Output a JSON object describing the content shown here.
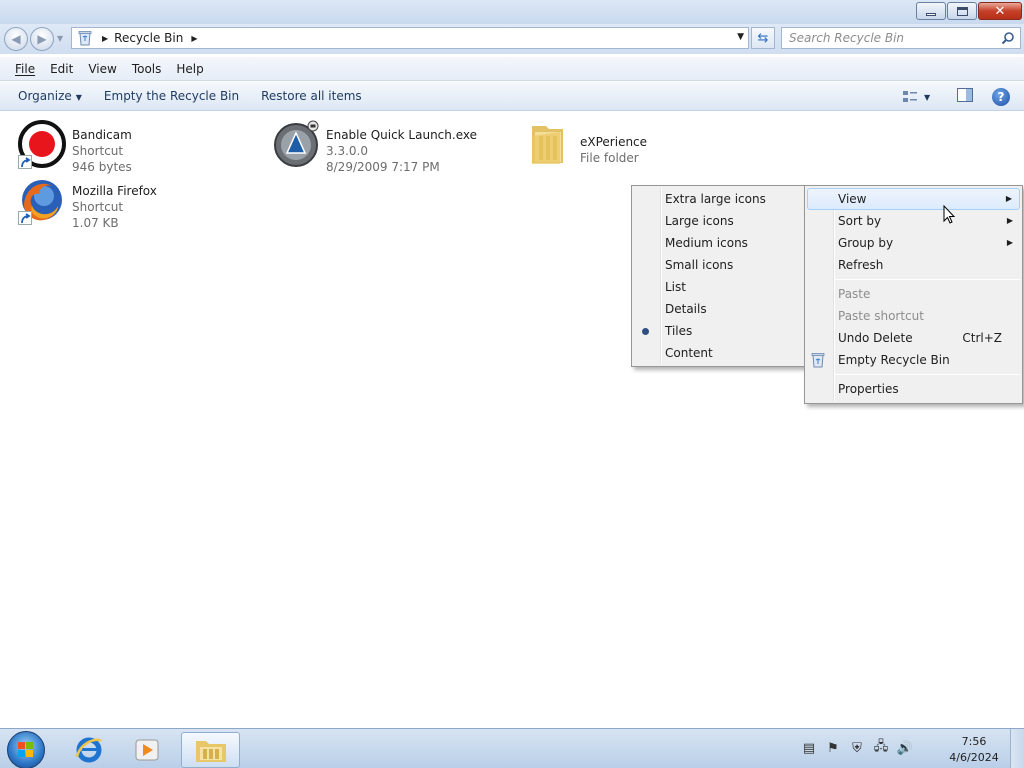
{
  "window": {
    "controls": {
      "minimize": "minimize",
      "maximize": "restore",
      "close": "close"
    }
  },
  "address": {
    "crumb": "Recycle Bin",
    "search_placeholder": "Search Recycle Bin"
  },
  "menubar": {
    "items": [
      {
        "label": "File",
        "accel": "F"
      },
      {
        "label": "Edit",
        "accel": "E"
      },
      {
        "label": "View",
        "accel": "V"
      },
      {
        "label": "Tools",
        "accel": "T"
      },
      {
        "label": "Help",
        "accel": "H"
      }
    ]
  },
  "commandbar": {
    "organize": "Organize",
    "empty": "Empty the Recycle Bin",
    "restore": "Restore all items"
  },
  "files": [
    {
      "name": "Bandicam",
      "line2": "Shortcut",
      "line3": "946 bytes",
      "icon": "bandicam-icon"
    },
    {
      "name": "Enable Quick Launch.exe",
      "line2": "3.3.0.0",
      "line3": "8/29/2009 7:17 PM",
      "icon": "exe-icon"
    },
    {
      "name": "eXPerience",
      "line2": "File folder",
      "icon": "folder-icon"
    },
    {
      "name": "Mozilla Firefox",
      "line2": "Shortcut",
      "line3": "1.07 KB",
      "icon": "firefox-icon"
    }
  ],
  "view_submenu": {
    "items": [
      {
        "label": "Extra large icons"
      },
      {
        "label": "Large icons"
      },
      {
        "label": "Medium icons"
      },
      {
        "label": "Small icons"
      },
      {
        "label": "List"
      },
      {
        "label": "Details"
      },
      {
        "label": "Tiles",
        "selected": true
      },
      {
        "label": "Content"
      }
    ]
  },
  "context_menu": {
    "view": "View",
    "sort_by": "Sort by",
    "group_by": "Group by",
    "refresh": "Refresh",
    "paste": "Paste",
    "paste_shortcut": "Paste shortcut",
    "undo_delete": "Undo Delete",
    "undo_shortcut": "Ctrl+Z",
    "empty_bin": "Empty Recycle Bin",
    "properties": "Properties"
  },
  "taskbar": {
    "time": "7:56",
    "date": "4/6/2024"
  }
}
